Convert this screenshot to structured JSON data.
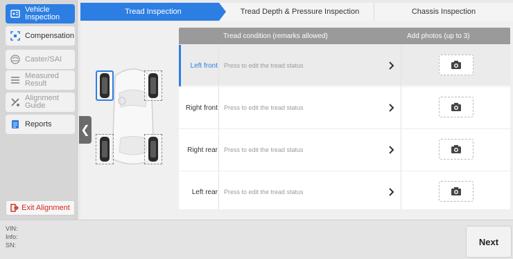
{
  "sidebar": {
    "items": [
      {
        "label": "Vehicle\nInspection",
        "icon": "vehicle-inspection-icon",
        "state": "active"
      },
      {
        "label": "Compensation",
        "icon": "compensation-icon",
        "state": "normal"
      },
      {
        "label": "Caster/SAI",
        "icon": "caster-icon",
        "state": "disabled"
      },
      {
        "label": "Measured\nResult",
        "icon": "measured-result-icon",
        "state": "disabled"
      },
      {
        "label": "Alignment\nGuide",
        "icon": "alignment-guide-icon",
        "state": "disabled"
      },
      {
        "label": "Reports",
        "icon": "reports-icon",
        "state": "normal"
      }
    ],
    "exit_label": "Exit Alignment"
  },
  "tabs": [
    {
      "label": "Tread Inspection",
      "active": true
    },
    {
      "label": "Tread Depth & Pressure Inspection",
      "active": false
    },
    {
      "label": "Chassis Inspection",
      "active": false
    }
  ],
  "table": {
    "header_condition": "Tread condition (remarks allowed)",
    "header_photos": "Add photos (up to 3)",
    "rows": [
      {
        "position": "Left front",
        "hint": "Press to edit the tread status",
        "active": true
      },
      {
        "position": "Right front",
        "hint": "Press to edit the tread status",
        "active": false
      },
      {
        "position": "Right rear",
        "hint": "Press to edit the tread status",
        "active": false
      },
      {
        "position": "Left rear",
        "hint": "Press to edit the tread status",
        "active": false
      }
    ]
  },
  "footer": {
    "vin_label": "VIN:",
    "info_label": "Info:",
    "sn_label": "SN:",
    "next_label": "Next"
  },
  "colors": {
    "accent": "#2d7ee3",
    "exit": "#d3261f"
  }
}
